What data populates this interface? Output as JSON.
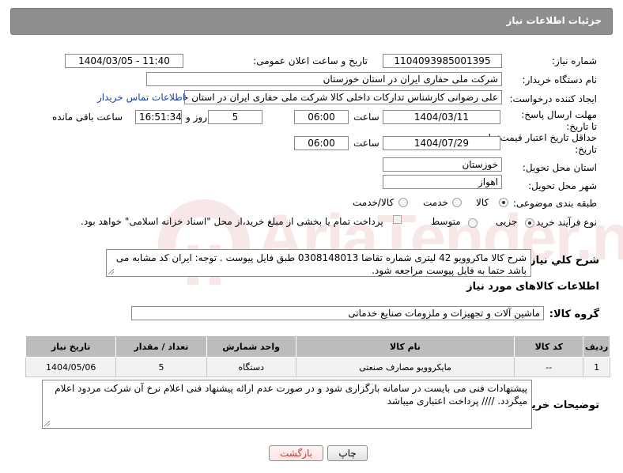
{
  "header": {
    "title": "جزئیات اطلاعات نیاز"
  },
  "labels": {
    "need_number": "شماره نیاز:",
    "announce_datetime": "تاریخ و ساعت اعلان عمومی:",
    "buyer_org": "نام دستگاه خریدار:",
    "requester": "ایجاد کننده درخواست:",
    "reply_deadline": "مهلت ارسال پاسخ: تا تاریخ:",
    "min_validity": "حداقل تاریخ اعتبار قیمت: تا تاریخ:",
    "time": "ساعت",
    "day_and": "روز و",
    "time_remaining": "ساعت باقی مانده",
    "delivery_province": "استان محل تحویل:",
    "delivery_city": "شهر محل تحویل:",
    "subject_category": "طبقه بندی موضوعی:",
    "purchase_process": "نوع فرآیند خرید :",
    "general_description": "شرح کلي نياز:",
    "goods_info": "اطلاعات کالاهای مورد نیاز",
    "goods_group": "گروه کالا:",
    "buyer_notes": "توضیحات خریدار:"
  },
  "values": {
    "need_number": "1104093985001395",
    "announce_datetime": "1404/03/05 - 11:40",
    "buyer_org": "شرکت ملی حفاری ایران در استان خوزستان",
    "requester": "علی رضوانی کارشناس تدارکات داخلی  کالا شرکت ملی حفاری ایران در استان خوزستان",
    "contact_link": "اطلاعات تماس خریدار",
    "reply_date": "1404/03/11",
    "reply_time": "06:00",
    "reply_days": "5",
    "reply_remaining": "16:51:34",
    "validity_date": "1404/07/29",
    "validity_time": "06:00",
    "province": "خوزستان",
    "city": "اهواز",
    "goods_group": "ماشین آلات و تجهیزات و ملزومات صنایع خدماتی",
    "general_description": "شرح کالا ماکروویو 42 لیتری شماره تقاضا 0308148013 طبق فایل پیوست . توجه: ایران کد مشابه می باشد حتما به فایل پیوست مراجعه شود.",
    "buyer_notes": "پیشنهادات فنی می بایست در سامانه بارگزاری شود و در صورت عدم ارائه پیشنهاد فنی اعلام نرخ آن شرکت مردود اعلام میگردد.  //// پرداخت اعتباری میباشد"
  },
  "category_options": {
    "goods": "کالا",
    "service": "خدمت",
    "goods_service": "کالا/خدمت",
    "selected": "کالا"
  },
  "process_options": {
    "partial": "جزیی",
    "medium": "متوسط",
    "treasury_note": "پرداخت تمام یا بخشی از مبلغ خرید،از محل \"اسناد خزانه اسلامی\" خواهد بود.",
    "selected": "جزیی"
  },
  "table": {
    "headers": [
      "ردیف",
      "کد کالا",
      "نام کالا",
      "واحد شمارش",
      "تعداد / مقدار",
      "تاریخ نیاز"
    ],
    "rows": [
      [
        "1",
        "--",
        "مایکروویو مصارف صنعتی",
        "دستگاه",
        "5",
        "1404/05/06"
      ]
    ]
  },
  "buttons": {
    "print": "چاپ",
    "back": "بازگشت"
  },
  "watermark": {
    "text": "AriaTender.net"
  },
  "colors": {
    "header_bg": "#8e8e8e",
    "table_header_bg": "#bcbcbc",
    "back_text": "#c0392b",
    "link": "#1a44a8"
  }
}
